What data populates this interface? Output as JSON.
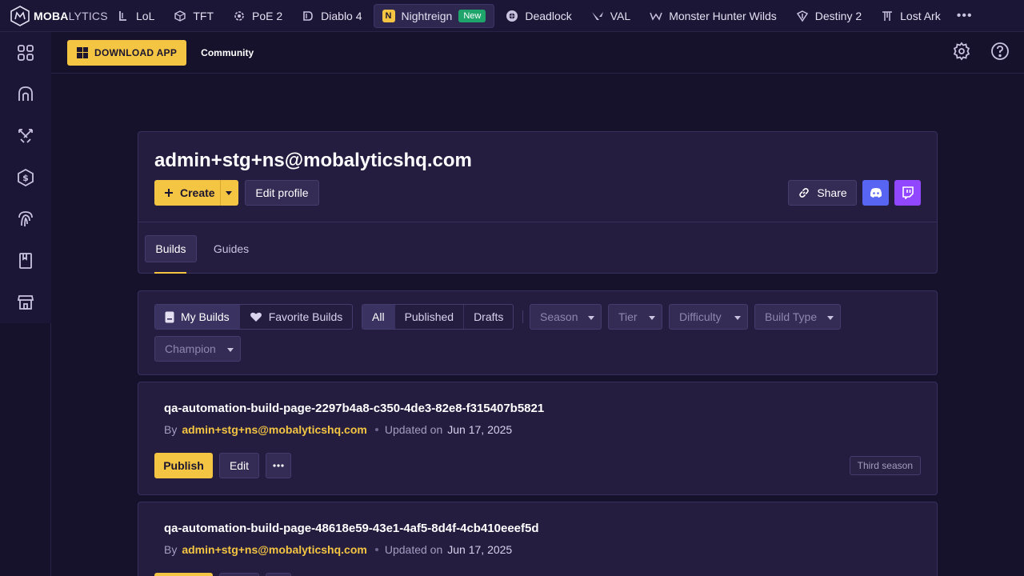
{
  "brand": {
    "name_bold": "MOBA",
    "name_thin": "LYTICS"
  },
  "games": [
    {
      "label": "LoL",
      "icon": "lol-icon"
    },
    {
      "label": "TFT",
      "icon": "tft-icon"
    },
    {
      "label": "PoE 2",
      "icon": "poe2-icon"
    },
    {
      "label": "Diablo 4",
      "icon": "diablo4-icon"
    },
    {
      "label": "Nightreign",
      "icon": "nightreign-icon",
      "badge": "New",
      "active": true
    },
    {
      "label": "Deadlock",
      "icon": "deadlock-icon"
    },
    {
      "label": "VAL",
      "icon": "valorant-icon"
    },
    {
      "label": "Monster Hunter Wilds",
      "icon": "mhw-icon"
    },
    {
      "label": "Destiny 2",
      "icon": "destiny2-icon"
    },
    {
      "label": "Lost Ark",
      "icon": "lostark-icon"
    }
  ],
  "subheader": {
    "download_label": "DOWNLOAD APP",
    "community_label": "Community"
  },
  "profile": {
    "email": "admin+stg+ns@mobalyticshq.com",
    "create_label": "Create",
    "edit_profile_label": "Edit profile",
    "share_label": "Share",
    "tabs": [
      "Builds",
      "Guides"
    ]
  },
  "filters": {
    "scope": [
      "My Builds",
      "Favorite Builds"
    ],
    "status": [
      "All",
      "Published",
      "Drafts"
    ],
    "dropdowns": [
      "Season",
      "Tier",
      "Difficulty",
      "Build Type",
      "Champion"
    ]
  },
  "builds": [
    {
      "title": "qa-automation-build-page-2297b4a8-c350-4de3-82e8-f315407b5821",
      "by": "By",
      "author": "admin+stg+ns@mobalyticshq.com",
      "updated_label": "Updated on",
      "date": "Jun 17, 2025",
      "publish_label": "Publish",
      "edit_label": "Edit",
      "season": "Third season"
    },
    {
      "title": "qa-automation-build-page-48618e59-43e1-4af5-8d4f-4cb410eeef5d",
      "by": "By",
      "author": "admin+stg+ns@mobalyticshq.com",
      "updated_label": "Updated on",
      "date": "Jun 17, 2025"
    }
  ],
  "colors": {
    "accent": "#f4c542",
    "background": "#17122b",
    "card": "#241d40",
    "discord": "#5865f2",
    "twitch": "#9146ff",
    "new_badge": "#1fa56b"
  }
}
